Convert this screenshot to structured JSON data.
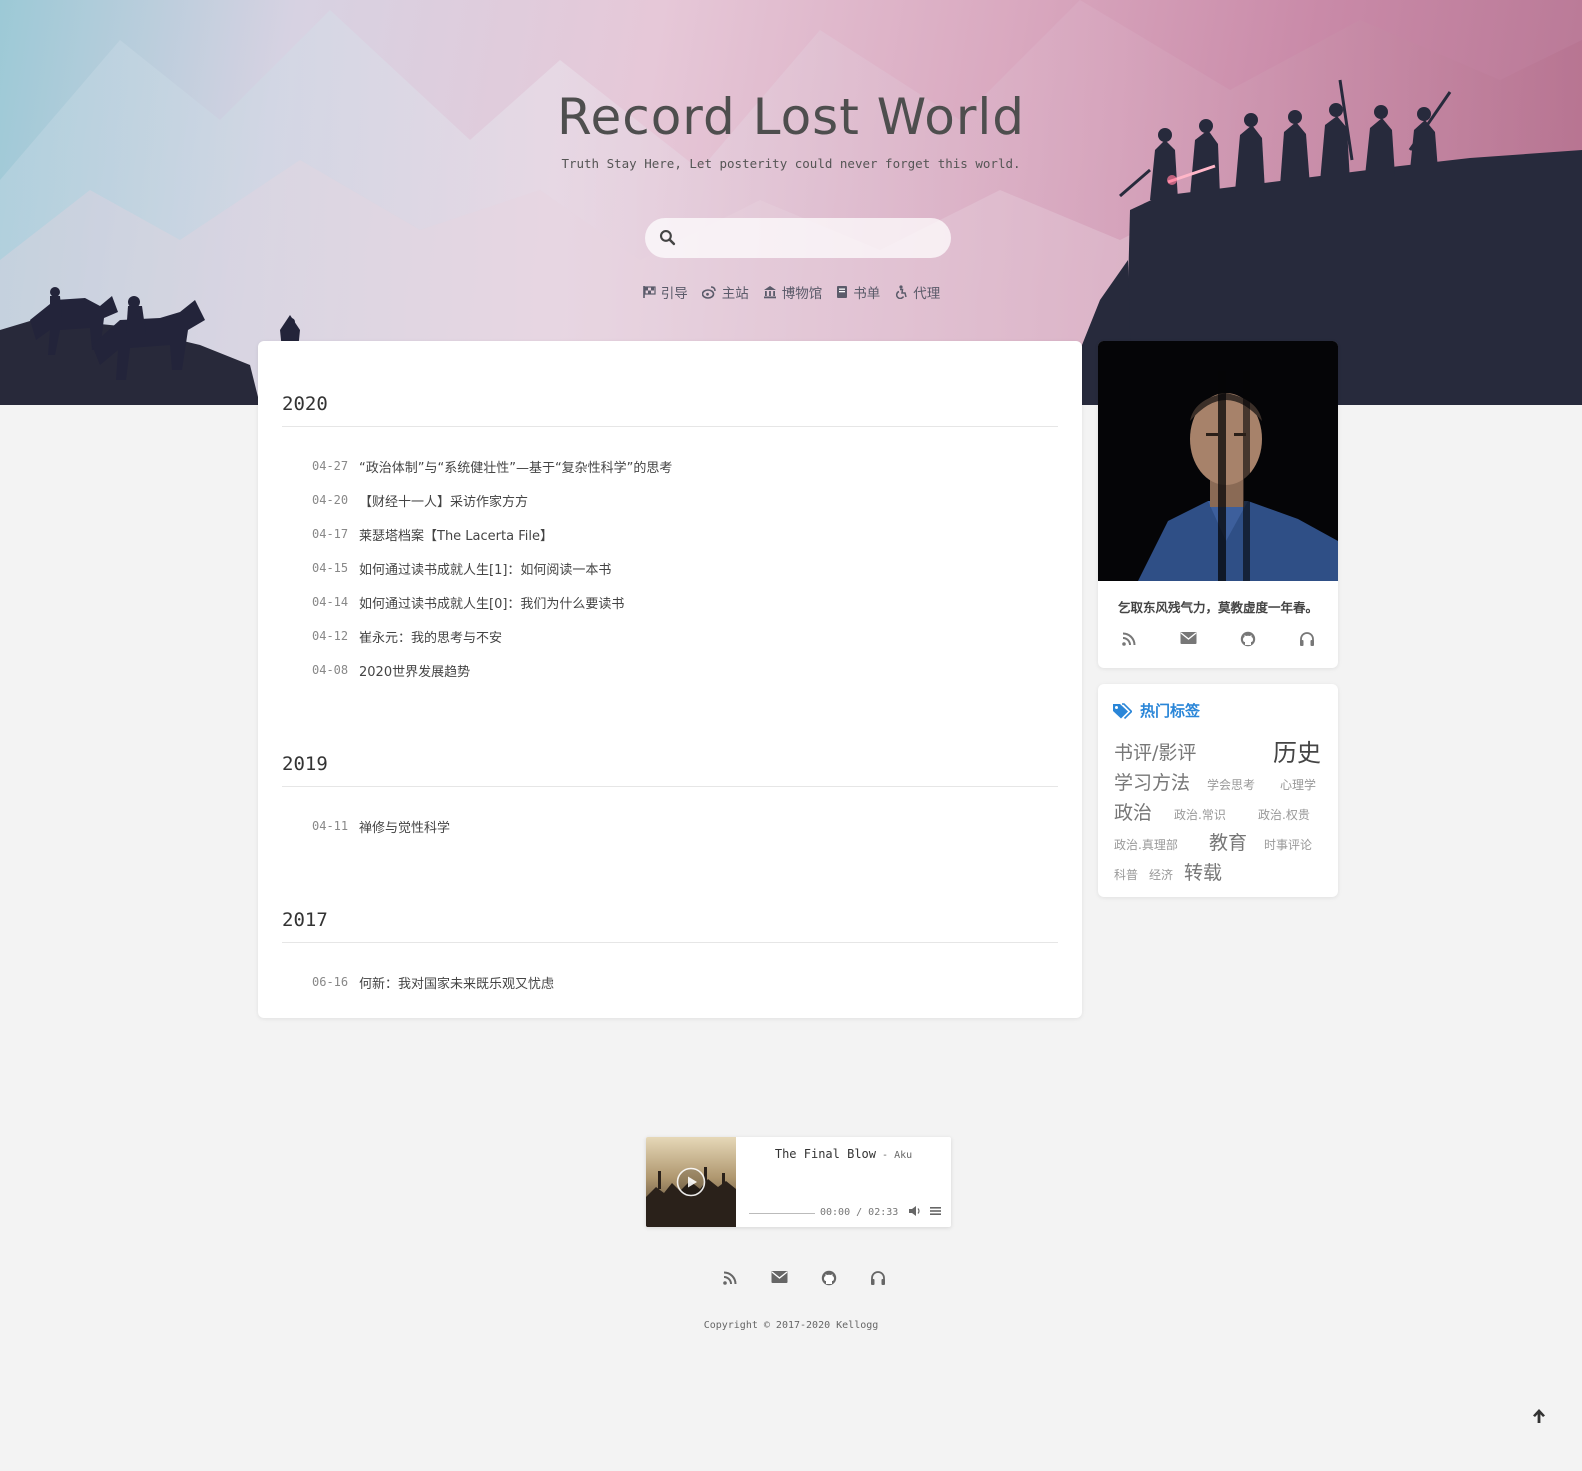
{
  "header": {
    "title": "Record Lost World",
    "subtitle": "Truth Stay Here, Let posterity could never forget this world.",
    "search_placeholder": ""
  },
  "nav": {
    "items": [
      {
        "label": "引导",
        "icon": "flag-checkered-icon"
      },
      {
        "label": "主站",
        "icon": "weibo-icon"
      },
      {
        "label": "博物馆",
        "icon": "bank-icon"
      },
      {
        "label": "书单",
        "icon": "book-icon"
      },
      {
        "label": "代理",
        "icon": "accessible-icon"
      }
    ]
  },
  "archive": {
    "years": [
      {
        "year": "2020",
        "posts": [
          {
            "date": "04-27",
            "title": "“政治体制”与“系统健壮性”—基于“复杂性科学”的思考"
          },
          {
            "date": "04-20",
            "title": "【财经十一人】采访作家方方"
          },
          {
            "date": "04-17",
            "title": "莱瑟塔档案【The Lacerta File】"
          },
          {
            "date": "04-15",
            "title": "如何通过读书成就人生[1]：如何阅读一本书"
          },
          {
            "date": "04-14",
            "title": "如何通过读书成就人生[0]：我们为什么要读书"
          },
          {
            "date": "04-12",
            "title": "崔永元：我的思考与不安"
          },
          {
            "date": "04-08",
            "title": "2020世界发展趋势"
          }
        ]
      },
      {
        "year": "2019",
        "posts": [
          {
            "date": "04-11",
            "title": "禅修与觉性科学"
          }
        ]
      },
      {
        "year": "2017",
        "posts": [
          {
            "date": "06-16",
            "title": "何新：我对国家未来既乐观又忧虑"
          }
        ]
      }
    ]
  },
  "profile": {
    "motto": "乞取东风残气力，莫教虚度一年春。",
    "icons": [
      "rss-icon",
      "envelope-icon",
      "github-icon",
      "headphones-icon"
    ]
  },
  "tags": {
    "heading": "热门标签",
    "items": [
      {
        "label": "书评/影评",
        "weight": 3
      },
      {
        "label": "历史",
        "weight": 5
      },
      {
        "label": "学习方法",
        "weight": 3
      },
      {
        "label": "学会思考",
        "weight": 1
      },
      {
        "label": "心理学",
        "weight": 1
      },
      {
        "label": "政治",
        "weight": 3
      },
      {
        "label": "政治.常识",
        "weight": 1
      },
      {
        "label": "政治.权贵",
        "weight": 1
      },
      {
        "label": "政治.真理部",
        "weight": 1
      },
      {
        "label": "教育",
        "weight": 3
      },
      {
        "label": "时事评论",
        "weight": 1
      },
      {
        "label": "科普",
        "weight": 1
      },
      {
        "label": "经济",
        "weight": 1
      },
      {
        "label": "转载",
        "weight": 3
      }
    ]
  },
  "player": {
    "song": "The Final Blow",
    "separator": " - ",
    "artist": "Aku",
    "current_time": "00:00",
    "time_separator": " / ",
    "duration": "02:33",
    "progress": 0
  },
  "footer": {
    "icons": [
      "rss-icon",
      "envelope-icon",
      "github-icon",
      "headphones-icon"
    ],
    "copyright": "Copyright © 2017-2020 Kellogg"
  },
  "colors": {
    "accent": "#2a86d8",
    "page_bg": "#f3f3f3",
    "card_bg": "#ffffff",
    "text": "#444444"
  }
}
